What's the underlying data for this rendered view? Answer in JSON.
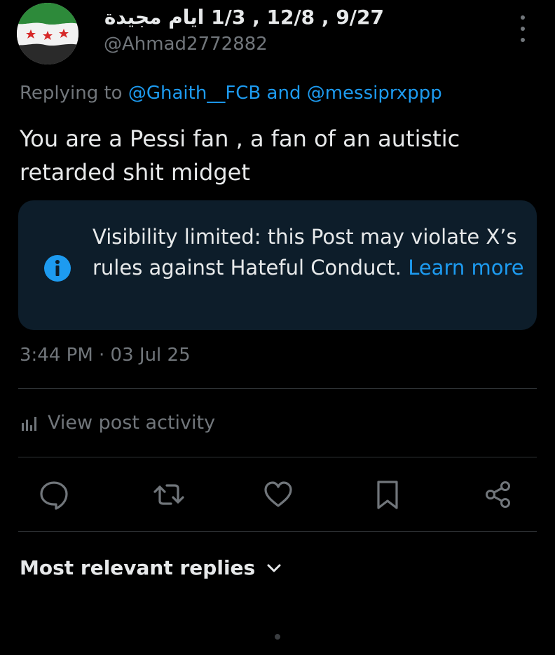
{
  "author": {
    "display_name": "9/27 , 12/8 , 1/3 ايام مجيدة",
    "handle": "@Ahmad2772882"
  },
  "reply": {
    "prefix": "Replying to",
    "user1": "@Ghaith__FCB",
    "joiner": "and",
    "user2": "@messiprxppp"
  },
  "post": {
    "text": "You are a Pessi fan , a fan of an autistic retarded shit midget",
    "timestamp": "3:44 PM · 03 Jul 25"
  },
  "notice": {
    "text": "Visibility limited: this Post may violate X’s rules against Hateful Conduct.",
    "link": "Learn more"
  },
  "activity": {
    "label": "View post activity"
  },
  "sort": {
    "label": "Most relevant replies"
  },
  "colors": {
    "background": "#000000",
    "accent": "#1d9bf0",
    "muted": "#71767b",
    "notice_bg": "#0d1d2a"
  }
}
